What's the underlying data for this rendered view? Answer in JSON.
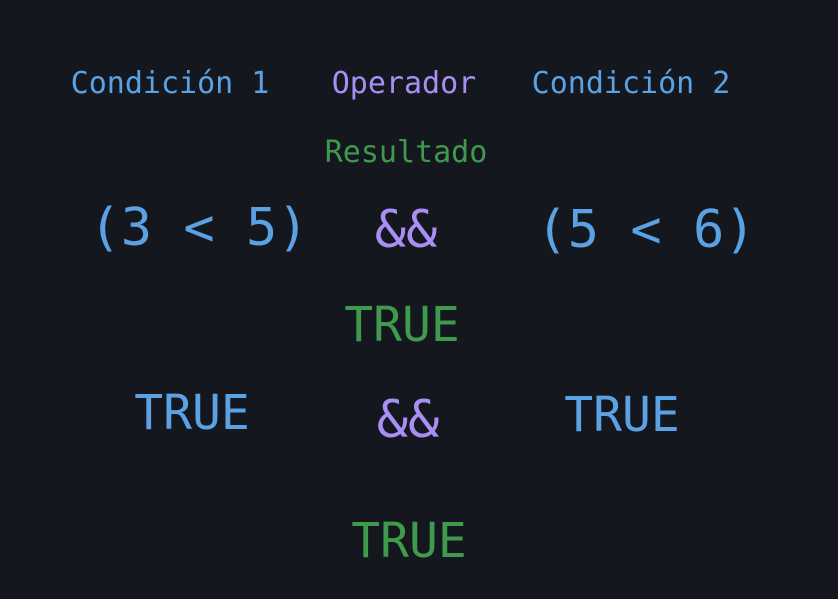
{
  "colors": {
    "background": "#14171d",
    "condition": "#5aa2e3",
    "operator": "#a98ef5",
    "result": "#3f9a4e"
  },
  "headers": {
    "condition1": "Condición 1",
    "operator": "Operador",
    "condition2": "Condición 2",
    "result": "Resultado"
  },
  "row1": {
    "condition1": "(3 < 5)",
    "operator": "&&",
    "condition2": "(5 < 6)",
    "result": "TRUE"
  },
  "row2": {
    "condition1": "TRUE",
    "operator": "&&",
    "condition2": "TRUE",
    "result": "TRUE"
  }
}
